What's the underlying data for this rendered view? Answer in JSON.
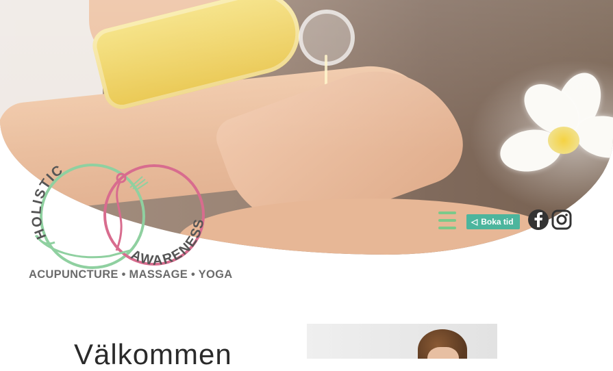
{
  "logo": {
    "word_left": "HOLISTIC",
    "word_right": "AWARENESS",
    "tagline": "ACUPUNCTURE • MASSAGE • YOGA"
  },
  "header": {
    "book_button_label": "Boka tid",
    "menu_icon": "hamburger-menu-icon",
    "social": [
      "facebook-icon",
      "instagram-icon"
    ]
  },
  "content": {
    "welcome_heading": "Välkommen"
  },
  "colors": {
    "accent_green": "#7bc98a",
    "button_teal": "#4cb59d",
    "logo_pink": "#d86c8e",
    "text_gray": "#6b6b6b"
  }
}
